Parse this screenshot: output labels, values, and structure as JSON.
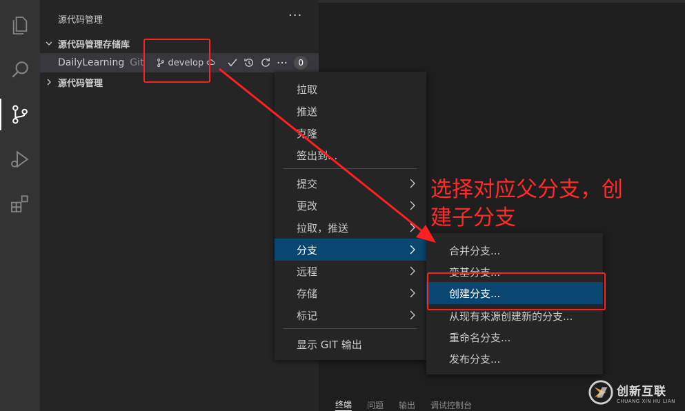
{
  "sidebar": {
    "title": "源代码管理",
    "more_label": "···",
    "section_repos": "源代码管理存储库",
    "section_scm": "源代码管理",
    "repo": {
      "name": "DailyLearning",
      "kind": "Git",
      "branch": "develop",
      "badge": "0"
    }
  },
  "context_menu": {
    "items": [
      "拉取",
      "推送",
      "克隆",
      "签出到..."
    ],
    "items_sub": [
      "提交",
      "更改",
      "拉取，推送",
      "分支",
      "远程",
      "存储",
      "标记"
    ],
    "items_bottom": [
      "显示 GIT 输出"
    ],
    "highlighted": "分支"
  },
  "branch_submenu": {
    "items": [
      "合并分支...",
      "变基分支...",
      "创建分支...",
      "从现有来源创建新的分支...",
      "重命名分支...",
      "发布分支..."
    ],
    "highlighted": "创建分支..."
  },
  "annotation": {
    "line1": "选择对应父分支，创",
    "line2": "建子分支",
    "color": "#ff2b2b"
  },
  "panel": {
    "tabs": [
      "终端",
      "问题",
      "输出",
      "调试控制台"
    ]
  },
  "watermark": {
    "cn": "创新互联",
    "en": "CHUANG XIN HU LIAN"
  },
  "colors": {
    "accent": "#094771",
    "activity_bar": "#333333",
    "sidebar": "#252526",
    "editor": "#1e1e1e"
  }
}
